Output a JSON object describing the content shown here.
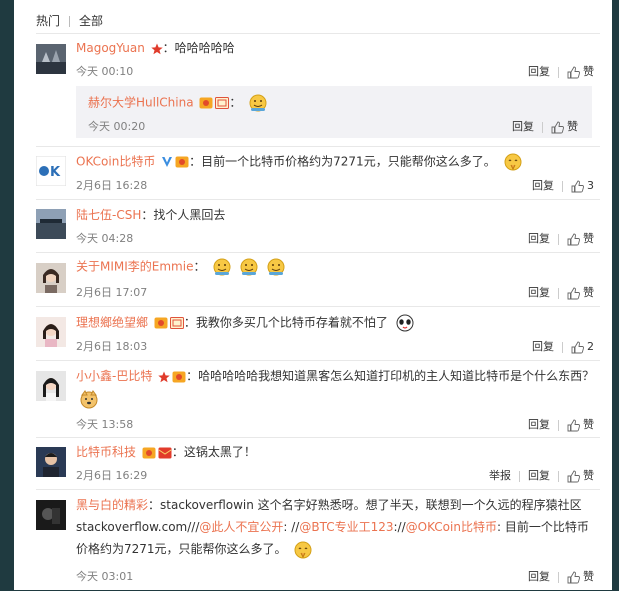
{
  "tabs": {
    "hot": "热门",
    "all": "全部"
  },
  "actions": {
    "reply": "回复",
    "like": "赞",
    "report": "举报"
  },
  "comments": [
    {
      "name": "MagogYuan",
      "text": "：哈哈哈哈哈",
      "time": "今天 00:10",
      "like": "赞"
    },
    {
      "name": "赫尔大学HullChina",
      "text": "：",
      "time": "今天 00:20",
      "like": "赞"
    },
    {
      "name": "OKCoin比特币",
      "text": "：目前一个比特币价格约为7271元，只能帮你这么多了。",
      "time": "2月6日 16:28",
      "like": "3"
    },
    {
      "name": "陆七伍-CSH",
      "text": "：找个人黑回去",
      "time": "今天 04:28",
      "like": "赞"
    },
    {
      "name": "关于MIMI李的Emmie",
      "text": "：",
      "time": "2月6日 17:07",
      "like": "赞"
    },
    {
      "name": "理想鄉绝望鄉",
      "text": "：我教你多买几个比特币存着就不怕了",
      "time": "2月6日 18:03",
      "like": "2"
    },
    {
      "name": "小小鑫-巴比特",
      "text": "：哈哈哈哈哈我想知道黑客怎么知道打印机的主人知道比特币是个什么东西？",
      "time": "今天 13:58",
      "like": "赞"
    },
    {
      "name": "比特币科技",
      "text": "：这锅太黑了！",
      "time": "2月6日 16:29",
      "like": "赞"
    },
    {
      "name": "黑与白的精彩",
      "text_a": "：stackoverflowin 这个名字好熟悉呀。想了半天，联想到一个久远的程序猿社区stackoverflow.com///",
      "mention1": "@此人不宜公开",
      "text_b": ": //",
      "mention2": "@BTC专业工123",
      "text_c": "://",
      "mention3": "@OKCoin比特币",
      "text_d": ": 目前一个比特币价格约为7271元，只能帮你这么多了。",
      "time": "今天 03:01",
      "like": "赞"
    }
  ],
  "colors": {
    "name": "#eb7350",
    "text": "#333333",
    "time": "#808080",
    "page_bg": "#1f3a40",
    "reply_bg": "#f2f2f5"
  }
}
